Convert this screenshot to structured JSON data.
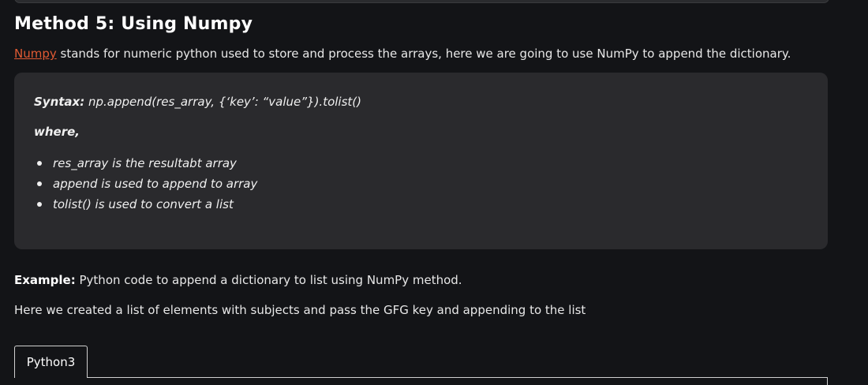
{
  "heading": "Method 5: Using Numpy",
  "intro": {
    "link_text": "Numpy",
    "text": " stands for numeric python used to store and process the arrays, here we are going to use NumPy to append the dictionary."
  },
  "syntax_box": {
    "syntax_label": "Syntax:",
    "syntax_code": " np.append(res_array, {‘key’: “value”}).tolist()",
    "where_label": "where,",
    "items": [
      "res_array is the resultabt array",
      "append is used to append to array",
      "tolist() is used to convert a list"
    ]
  },
  "example": {
    "label": "Example:",
    "text": " Python code to append a dictionary to list using NumPy method."
  },
  "description": "Here we created a list of elements with subjects and pass the GFG key and appending to the list",
  "code_tabs": [
    "Python3"
  ],
  "colors": {
    "background": "#131417",
    "panel": "#2a2a2d",
    "link": "#e05a33"
  }
}
